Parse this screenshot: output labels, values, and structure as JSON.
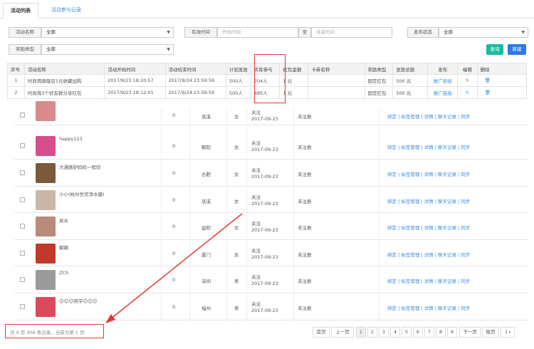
{
  "tabs": [
    {
      "label": "活动列表"
    },
    {
      "label": "活动参与记录"
    }
  ],
  "filters": {
    "activity_name_label": "活动名称",
    "activity_name_value": "全部",
    "valid_time_label": "有效时间",
    "start_placeholder": "开始时间",
    "to_label": "至",
    "end_placeholder": "结束时间",
    "publish_status_label": "发布状态",
    "publish_status_value": "全部",
    "reward_type_label": "奖励类型",
    "reward_type_value": "全部",
    "query_button": "查询",
    "new_button": "新建"
  },
  "activity_table": {
    "headers": [
      "序号",
      "活动名称",
      "活动开始时间",
      "活动结束时间",
      "计划发放",
      "实际参与",
      "红包金额",
      "卡券名称",
      "奖励类型",
      "发放总额",
      "发布",
      "编辑",
      "删除"
    ],
    "rows": [
      {
        "no": "1",
        "name": "时尚周旗舰店1元收藏加购",
        "start": "2017/9/23 18:20:57",
        "end": "2017/9/24 23:59:59",
        "plan": "500人",
        "actual": "704人",
        "amount": "1 元",
        "card": "",
        "reward_type": "固定红包",
        "total": "500 元",
        "publish": "推广链接"
      },
      {
        "no": "2",
        "name": "时尚周3个好友群分享红包",
        "start": "2017/9/23 18:12:01",
        "end": "2017/9/24 23:59:59",
        "plan": "500人",
        "actual": "485人",
        "amount": "1 元",
        "card": "",
        "reward_type": "固定红包",
        "total": "500 元",
        "publish": "推广链接"
      }
    ]
  },
  "users": [
    {
      "name": "",
      "count": "0",
      "city": "巫溪",
      "gender": "女",
      "status": "关注",
      "date": "2017-09-23",
      "reg": "未注册",
      "ops": "绑定 | 标签管理 | 详情 | 聊天记录 | 同步",
      "color": "#d98a8a"
    },
    {
      "name": "happy123",
      "count": "0",
      "city": "朝阳",
      "gender": "女",
      "status": "关注",
      "date": "2017-09-23",
      "reg": "未注册",
      "ops": "绑定 | 标签管理 | 详情 | 聊天记录 | 同步",
      "color": "#d64f8c"
    },
    {
      "name": "大通路驴妈妈～程欣",
      "count": "0",
      "city": "合肥",
      "gender": "女",
      "status": "关注",
      "date": "2017-09-23",
      "reg": "未注册",
      "ops": "绑定 | 标签管理 | 详情 | 聊天记录 | 同步",
      "color": "#7a5a3a"
    },
    {
      "name": "小小(杭州世贸净水器)",
      "count": "0",
      "city": "巫溪",
      "gender": "女",
      "status": "关注",
      "date": "2017-09-23",
      "reg": "未注册",
      "ops": "绑定 | 标签管理 | 详情 | 聊天记录 | 同步",
      "color": "#c9b8a8"
    },
    {
      "name": "易水",
      "count": "0",
      "city": "益阳",
      "gender": "女",
      "status": "关注",
      "date": "2017-09-23",
      "reg": "未注册",
      "ops": "绑定 | 标签管理 | 详情 | 聊天记录 | 同步",
      "color": "#b88a7a"
    },
    {
      "name": "朝朝",
      "count": "0",
      "city": "厦门",
      "gender": "女",
      "status": "关注",
      "date": "2017-09-23",
      "reg": "未注册",
      "ops": "绑定 | 标签管理 | 详情 | 聊天记录 | 同步",
      "color": "#c0392b"
    },
    {
      "name": "ZCS",
      "count": "0",
      "city": "深圳",
      "gender": "男",
      "status": "关注",
      "date": "2017-09-23",
      "reg": "未注册",
      "ops": "绑定 | 标签管理 | 详情 | 聊天记录 | 同步",
      "color": "#9a9a9a"
    },
    {
      "name": "☺☺☺阿学☺☺☺",
      "count": "0",
      "city": "福州",
      "gender": "男",
      "status": "关注",
      "date": "2017-09-23",
      "reg": "未注册",
      "ops": "绑定 | 标签管理 | 详情 | 聊天记录 | 同步",
      "color": "#d94a5a"
    }
  ],
  "footer": {
    "summary": "共 9 页 408 条记录，当前为第 1 页"
  },
  "pager": {
    "first": "首页",
    "prev": "上一页",
    "pages": [
      "1",
      "2",
      "3",
      "4",
      "5",
      "6",
      "7",
      "8",
      "9"
    ],
    "next": "下一页",
    "last": "尾页",
    "select": "1",
    "current": "1"
  },
  "colors": {
    "accent": "#3a8ee6",
    "highlight": "#e53935",
    "query": "#1abc9c",
    "new": "#2d7be5"
  }
}
